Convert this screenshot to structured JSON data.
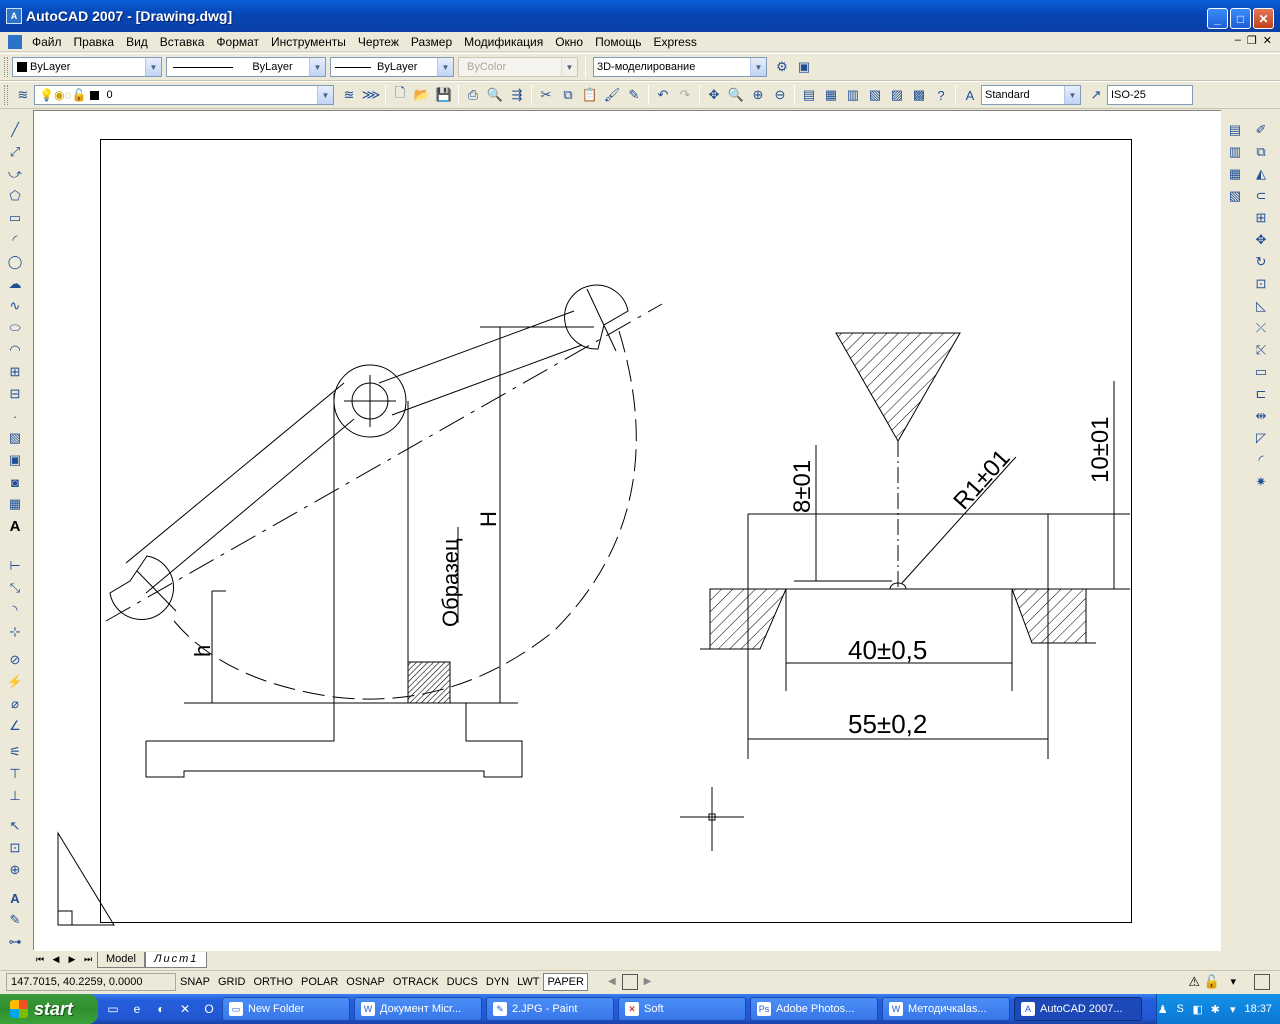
{
  "window": {
    "title": "AutoCAD 2007 - [Drawing.dwg]",
    "app_icon": "autocad-icon"
  },
  "menu": [
    "Файл",
    "Правка",
    "Вид",
    "Вставка",
    "Формат",
    "Инструменты",
    "Чертеж",
    "Размер",
    "Модификация",
    "Окно",
    "Помощь",
    "Express"
  ],
  "properties_toolbar": {
    "color": "ByLayer",
    "linetype": "ByLayer",
    "lineweight": "ByLayer",
    "plotstyle": "ByColor",
    "workspace": "3D-моделирование"
  },
  "standard_toolbar": {
    "layer": "0",
    "text_style": "Standard",
    "dim_style": "ISO-25"
  },
  "drawing": {
    "labels": {
      "sample": "Образец",
      "height": "H",
      "h": "h",
      "dim_8": "8±01",
      "dim_10": "10±01",
      "radius": "R1±01",
      "dim_40": "40±0,5",
      "dim_55": "55±0,2"
    }
  },
  "layout_tabs": {
    "model": "Model",
    "layout1": "Лист1"
  },
  "statusbar": {
    "coords": "147.7015, 40.2259, 0.0000",
    "buttons": [
      {
        "label": "SNAP",
        "on": false
      },
      {
        "label": "GRID",
        "on": false
      },
      {
        "label": "ORTHO",
        "on": false
      },
      {
        "label": "POLAR",
        "on": false
      },
      {
        "label": "OSNAP",
        "on": false
      },
      {
        "label": "OTRACK",
        "on": false
      },
      {
        "label": "DUCS",
        "on": false
      },
      {
        "label": "DYN",
        "on": false
      },
      {
        "label": "LWT",
        "on": false
      },
      {
        "label": "PAPER",
        "on": true
      }
    ]
  },
  "taskbar": {
    "start": "start",
    "tasks": [
      {
        "label": "New Folder",
        "icon": "folder-icon",
        "active": false
      },
      {
        "label": "Документ Micr...",
        "icon": "word-icon",
        "active": false
      },
      {
        "label": "2.JPG - Paint",
        "icon": "paint-icon",
        "active": false
      },
      {
        "label": "Soft",
        "icon": "close-x-icon",
        "active": false
      },
      {
        "label": "Adobe Photos...",
        "icon": "photoshop-icon",
        "active": false
      },
      {
        "label": "Методичкаlas...",
        "icon": "word-icon",
        "active": false
      },
      {
        "label": "AutoCAD 2007...",
        "icon": "autocad-icon",
        "active": true
      }
    ],
    "clock": "18:37"
  }
}
